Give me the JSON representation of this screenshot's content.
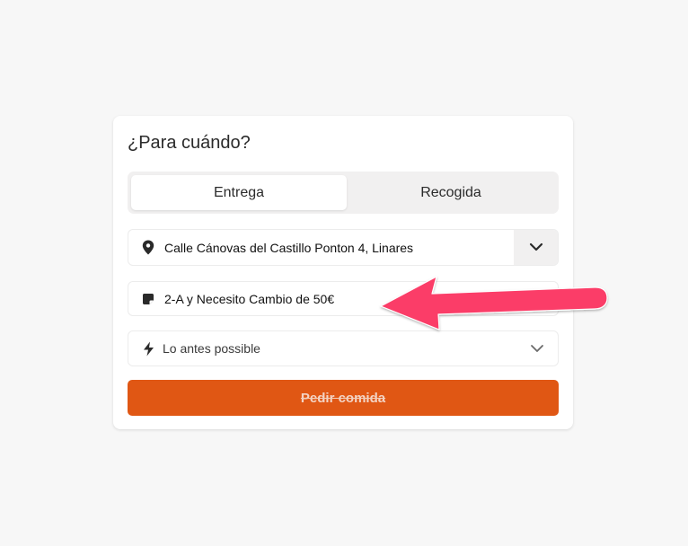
{
  "colors": {
    "accent": "#e05714",
    "annotation_arrow": "#fb3c68",
    "background": "#f7f7f7",
    "tab_track": "#f1f0f0"
  },
  "form": {
    "title": "¿Para cuándo?",
    "tabs": [
      {
        "label": "Entrega",
        "active": true
      },
      {
        "label": "Recogida",
        "active": false
      }
    ],
    "address": {
      "icon": "location-pin-icon",
      "value": "Calle Cánovas del Castillo Ponton 4, Linares",
      "toggle_icon": "chevron-down-icon"
    },
    "note": {
      "icon": "note-icon",
      "value": "2-A y Necesito Cambio de 50€"
    },
    "time": {
      "icon": "lightning-icon",
      "value": "Lo antes possible",
      "toggle_icon": "chevron-down-icon"
    },
    "submit_label": "Pedir comida"
  },
  "annotation": {
    "icon": "arrow-left-icon",
    "points_to": "note-field"
  }
}
